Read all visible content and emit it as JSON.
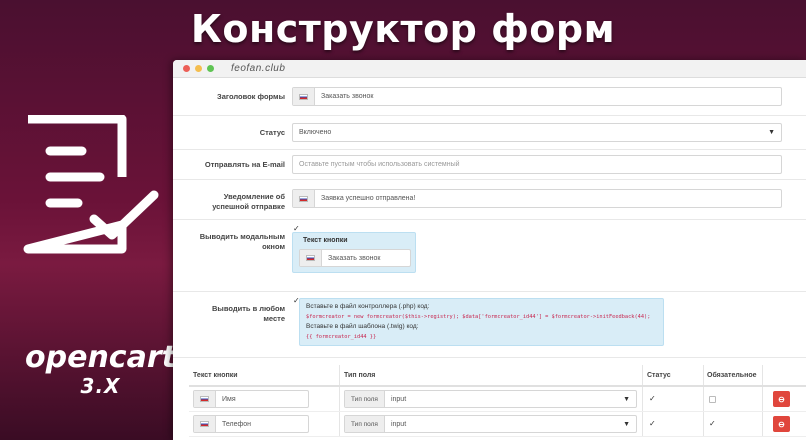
{
  "banner": {
    "title": "Конструктор форм"
  },
  "branding": {
    "product": "opencart",
    "version": "3.X",
    "logo_icon": "form-checkmark-icon"
  },
  "window": {
    "site": "feofan.club"
  },
  "form": {
    "heading": {
      "label": "Заголовок формы",
      "value": "Заказать звонок"
    },
    "status": {
      "label": "Статус",
      "value": "Включено"
    },
    "email": {
      "label": "Отправлять на E-mail",
      "placeholder": "Оставьте пустым чтобы использовать системный"
    },
    "success": {
      "label_line1": "Уведомление об",
      "label_line2": "успешной отправке",
      "value": "Заявка успешно отправлена!"
    },
    "modal": {
      "label_line1": "Выводить модальным",
      "label_line2": "окном",
      "checked": true,
      "button_text_heading": "Текст кнопки",
      "button_text_value": "Заказать звонок"
    },
    "anywhere": {
      "label_line1": "Выводить в любом",
      "label_line2": "месте",
      "checked": true,
      "controller_hint": "Вставьте в файл контроллера (.php) код:",
      "controller_code": "$formcreator = new formcreator($this->registry); $data['formcreator_id44'] = $formcreator->initFeedback(44);",
      "template_hint": "Вставьте в файл шаблона (.twig) код:",
      "template_code": "{{ formcreator_id44 }}"
    }
  },
  "fields_table": {
    "headers": {
      "button_text": "Текст кнопки",
      "field_type": "Тип поля",
      "status": "Статус",
      "required": "Обязательное"
    },
    "rows": [
      {
        "name": "Имя",
        "type_addon": "Тип поля",
        "type": "input",
        "status": true,
        "required": false
      },
      {
        "name": "Телефон",
        "type_addon": "Тип поля",
        "type": "input",
        "status": true,
        "required": true
      }
    ],
    "delete_icon": "minus-circle-icon"
  },
  "colors": {
    "accent_bg": "#6a1238",
    "info_box": "#d9edf7",
    "danger": "#e0463c"
  }
}
